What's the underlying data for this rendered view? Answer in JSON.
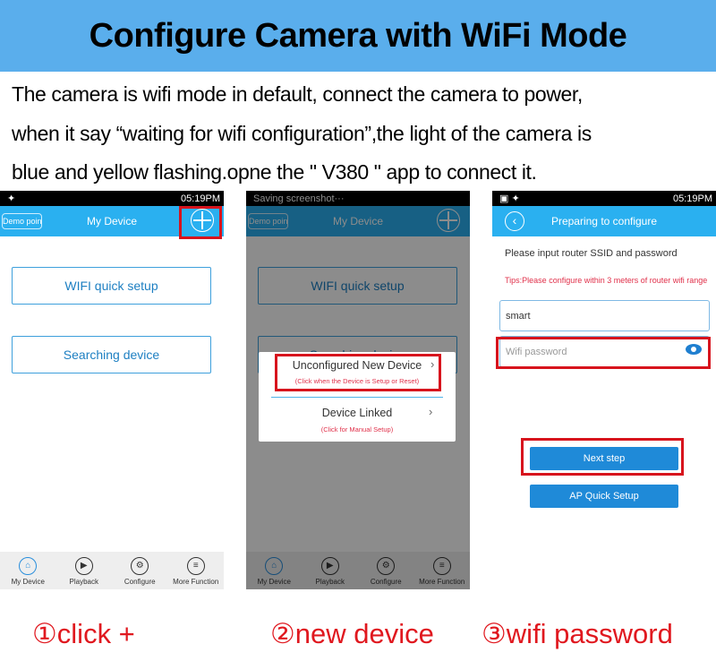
{
  "title": "Configure Camera with WiFi Mode",
  "intro": [
    "The camera is wifi mode in default, connect the camera to power,",
    "when it say “waiting for wifi configuration”,the light of the camera is",
    "blue and yellow flashing.opne the \" V380 \"  app to connect it."
  ],
  "status": {
    "time": "05:19PM",
    "saving": "Saving screenshot···"
  },
  "phone1": {
    "back": "Demo point",
    "title": "My Device",
    "wifi_setup": "WIFI quick setup",
    "searching": "Searching device"
  },
  "nav": [
    "My Device",
    "Playback",
    "Configure",
    "More Function"
  ],
  "phone2": {
    "popup": {
      "item1": "Unconfigured New Device",
      "item1_hint": "(Click when the Device is Setup or Reset)",
      "item2": "Device Linked",
      "item2_hint": "(Click for Manual Setup)"
    }
  },
  "phone3": {
    "title": "Preparing to configure",
    "prompt": "Please input router SSID and password",
    "tips": "Tips:Please configure within 3 meters of router wifi range",
    "ssid": "smart",
    "password_placeholder": "Wifi password",
    "next": "Next step",
    "ap": "AP Quick Setup"
  },
  "captions": [
    "①click +",
    "②new device",
    "③wifi password"
  ],
  "colors": {
    "banner": "#5aaeec",
    "appbar": "#2ab0f0",
    "highlight": "#d7141d",
    "caption": "#e0181f"
  }
}
